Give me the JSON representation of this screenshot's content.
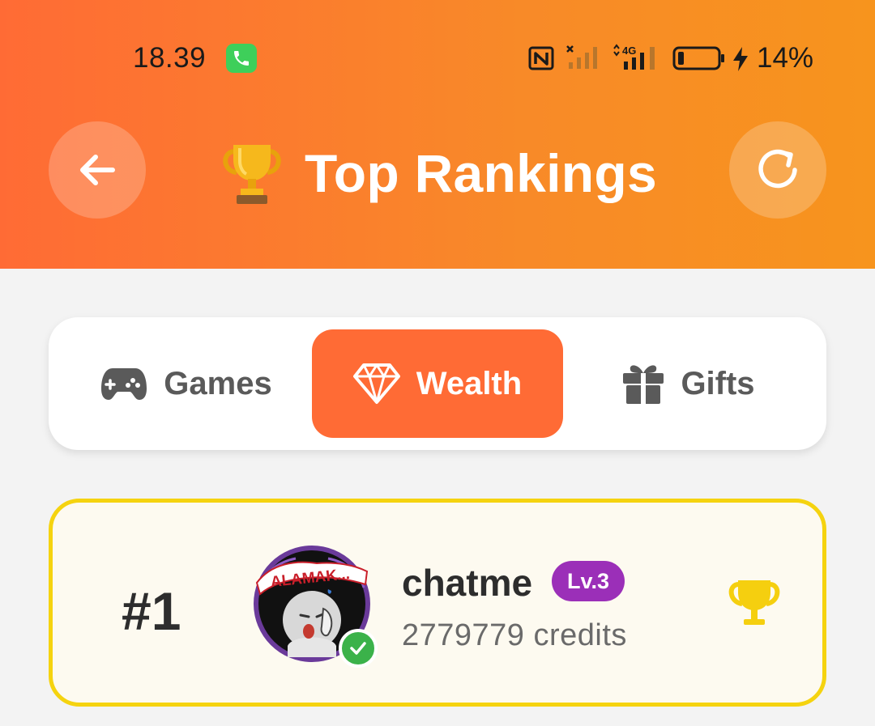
{
  "status_bar": {
    "time": "18.39",
    "battery_percent": "14%",
    "network_label": "4G",
    "icons": [
      "phone-call-icon",
      "nfc-icon",
      "signal-no-service-icon",
      "signal-4g-icon",
      "battery-icon",
      "charging-bolt-icon"
    ]
  },
  "header": {
    "title": "Top Rankings",
    "title_icon": "trophy-icon",
    "back_icon": "arrow-left-icon",
    "refresh_icon": "refresh-icon"
  },
  "tabs": [
    {
      "label": "Games",
      "icon": "gamepad-icon",
      "active": false
    },
    {
      "label": "Wealth",
      "icon": "diamond-icon",
      "active": true
    },
    {
      "label": "Gifts",
      "icon": "gift-icon",
      "active": false
    }
  ],
  "rankings": [
    {
      "rank": "#1",
      "username": "chatme",
      "level": "Lv.3",
      "credits": "2779779 credits",
      "avatar_text": "ALAMAK...",
      "verified": true
    }
  ],
  "colors": {
    "header_gradient_start": "#ff6b35",
    "header_gradient_end": "#f7941d",
    "accent": "#ff6b35",
    "card_border": "#f5d30f",
    "level_badge": "#9b2fb8",
    "verified": "#3bb24a"
  }
}
